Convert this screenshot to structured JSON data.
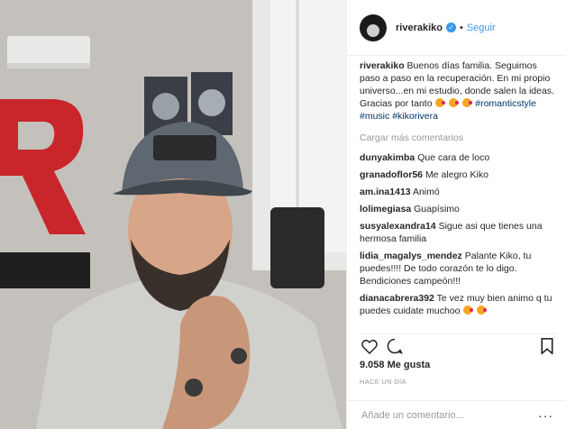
{
  "post": {
    "username": "riverakiko",
    "follow_label": "Seguir",
    "separator": "•",
    "caption_user": "riverakiko",
    "caption_text": "Buenos días familia. Seguimos paso a paso en la recuperación. En mi propio universo...en mi estudio, donde salen la ideas. Gracias por tanto",
    "hashtags": [
      "#romanticstyle",
      "#music",
      "#kikorivera"
    ],
    "load_more": "Cargar más comentarios",
    "comments": [
      {
        "user": "dunyakimba",
        "text": "Que cara de loco"
      },
      {
        "user": "granadoflor56",
        "text": "Me alegro Kiko"
      },
      {
        "user": "am.ina1413",
        "text": "Animó"
      },
      {
        "user": "lolimegiasa",
        "text": "Guapísimo"
      },
      {
        "user": "susyalexandra14",
        "text": "Sigue asi que tienes una hermosa familia"
      },
      {
        "user": "lidia_magalys_mendez",
        "text": "Palante Kiko, tu puedes!!!! De todo corazón te lo digo. Bendiciones campeón!!!"
      },
      {
        "user": "dianacabrera392",
        "text": "Te vez muy bien animo q tu puedes cuidate muchoo"
      }
    ],
    "likes": "9.058 Me gusta",
    "time": "HACE UN DÍA",
    "add_comment_placeholder": "Añade un comentario...",
    "icons": {
      "like": "heart-icon",
      "comment": "comment-icon",
      "save": "bookmark-icon",
      "verified": "verified-badge-icon",
      "more": "more-options-icon"
    },
    "colors": {
      "link": "#3897f0",
      "muted": "#999999",
      "hashtag": "#003569"
    }
  }
}
